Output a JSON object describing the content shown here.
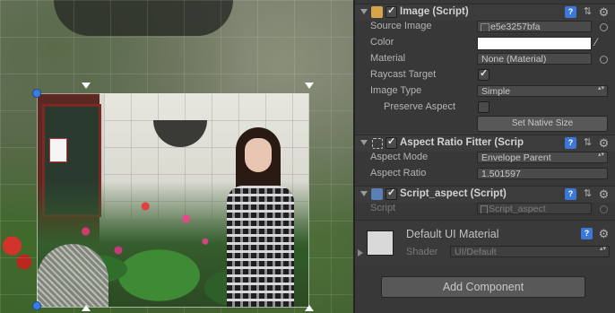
{
  "image_component": {
    "title": "Image (Script)",
    "source_image_label": "Source Image",
    "source_image_value": "e5e3257bfa",
    "color_label": "Color",
    "color_value": "#ffffff",
    "material_label": "Material",
    "material_value": "None (Material)",
    "raycast_label": "Raycast Target",
    "raycast_checked": true,
    "image_type_label": "Image Type",
    "image_type_value": "Simple",
    "preserve_aspect_label": "Preserve Aspect",
    "preserve_aspect_checked": false,
    "set_native_size_label": "Set Native Size"
  },
  "aspect_ratio_fitter": {
    "title": "Aspect Ratio Fitter (Scrip",
    "aspect_mode_label": "Aspect Mode",
    "aspect_mode_value": "Envelope Parent",
    "aspect_ratio_label": "Aspect Ratio",
    "aspect_ratio_value": "1.501597"
  },
  "script_aspect": {
    "title": "Script_aspect (Script)",
    "script_label": "Script",
    "script_value": "Script_aspect"
  },
  "material": {
    "title": "Default UI Material",
    "shader_label": "Shader",
    "shader_value": "UI/Default"
  },
  "add_component_label": "Add Component",
  "colors": {
    "inspector_bg": "#383838",
    "help_icon": "#3b78d8",
    "handle": "#3b7ce0"
  }
}
